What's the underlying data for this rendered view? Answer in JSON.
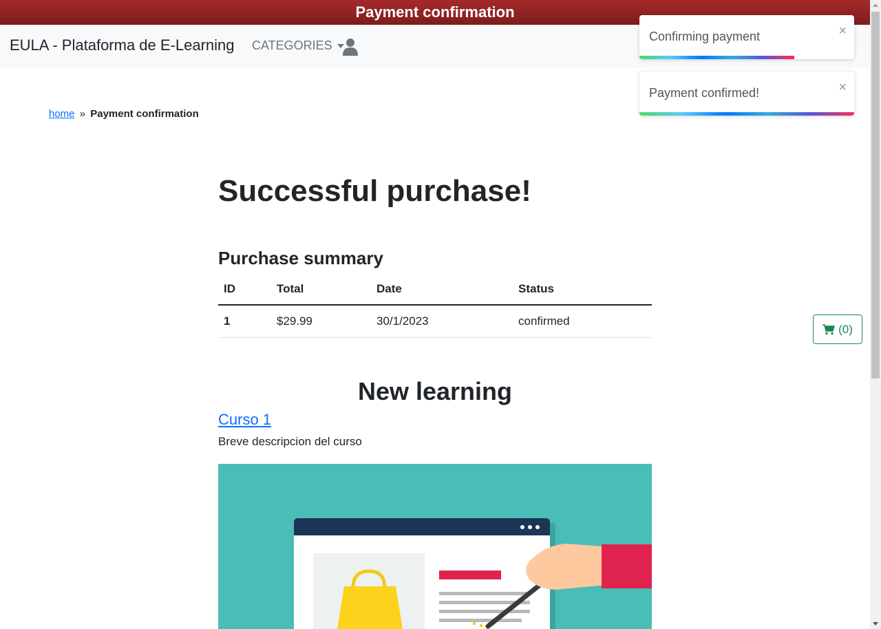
{
  "banner": {
    "title": "Payment confirmation"
  },
  "navbar": {
    "brand": "EULA - Plataforma de E-Learning",
    "categories_label": "CATEGORIES"
  },
  "toasts": [
    {
      "message": "Confirming payment",
      "close": "×",
      "progress": 0.72
    },
    {
      "message": "Payment confirmed!",
      "close": "×",
      "progress": 1.0
    }
  ],
  "breadcrumb": {
    "home": "home",
    "separator": "»",
    "current": "Payment confirmation"
  },
  "main": {
    "heading": "Successful purchase!",
    "summary_heading": "Purchase summary",
    "table": {
      "headers": [
        "ID",
        "Total",
        "Date",
        "Status"
      ],
      "rows": [
        {
          "id": "1",
          "total": "$29.99",
          "date": "30/1/2023",
          "status": "confirmed"
        }
      ]
    },
    "new_learning_heading": "New learning",
    "course": {
      "title": "Curso 1",
      "description": "Breve descripcion del curso"
    }
  },
  "cart": {
    "label": "(0)"
  },
  "colors": {
    "banner": "#8b2323",
    "link": "#0d6efd",
    "cart": "#198754",
    "image_bg": "#4abdb7"
  },
  "icons": {
    "user": "user-icon",
    "cart": "cart-icon",
    "caret": "chevron-down-icon",
    "close": "close-icon"
  }
}
